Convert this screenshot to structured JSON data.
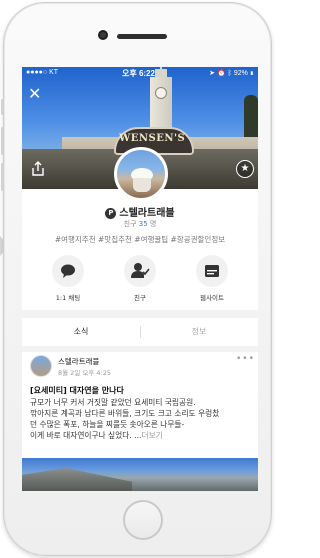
{
  "status_bar": {
    "carrier": "●●●●○ KT",
    "time": "오후 6:22",
    "battery": "92%"
  },
  "cover": {
    "sign_text": "WENSEN'S"
  },
  "profile": {
    "name": "스텔라트래블",
    "friend_label": "친구",
    "friend_count": "35",
    "friend_unit": "명",
    "tags": "#여행지추천 #맛집추천 #여행꿀팁 #항공권할인정보"
  },
  "actions": [
    {
      "label": "1:1 채팅",
      "icon": "chat-bubble-icon"
    },
    {
      "label": "친구",
      "icon": "add-friend-icon"
    },
    {
      "label": "웹사이트",
      "icon": "website-icon"
    }
  ],
  "tabs": [
    {
      "label": "소식"
    },
    {
      "label": "정보"
    }
  ],
  "post": {
    "author": "스텔라트래블",
    "date": "8월 2일 오후 4:25",
    "more": "•••",
    "title": "[요세미티] 대자연을 만나다",
    "body_lines": [
      "규모가 너무 커서 거짓말 같았던 요세미티 국립공원.",
      "깎아지른 계곡과 남다른 바위들, 크기도 크고 소리도 우렁찼",
      "던 수많은 폭포, 하늘을 찌를듯 솟아오른 나무들-",
      "이게 바로 대자연이구나 싶었다. ..."
    ],
    "more_link": "더보기"
  },
  "colors": {
    "accent": "#3d7fd8",
    "text": "#222222",
    "muted": "#888888"
  }
}
